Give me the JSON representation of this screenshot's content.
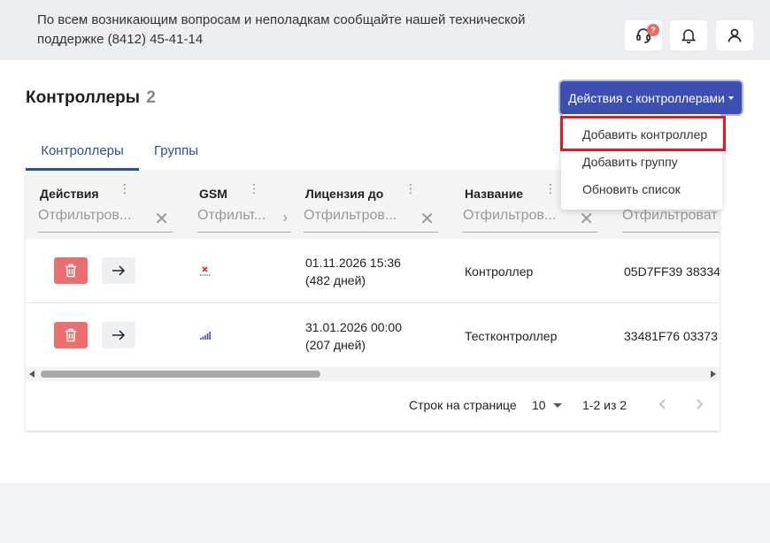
{
  "header": {
    "support_text": "По всем возникающим вопросам и неполадкам сообщайте нашей технической поддержке (8412) 45-41-14",
    "support_badge": "?",
    "icons": [
      "headset-icon",
      "bell-icon",
      "user-icon"
    ]
  },
  "page": {
    "title": "Контроллеры",
    "count": "2"
  },
  "actions": {
    "button_label": "Действия с контроллерами",
    "menu": [
      {
        "label": "Добавить контроллер",
        "highlighted": true
      },
      {
        "label": "Добавить группу"
      },
      {
        "label": "Обновить список"
      }
    ],
    "highlight_color": "#e01b22"
  },
  "tabs": [
    {
      "label": "Контроллеры",
      "active": true
    },
    {
      "label": "Группы",
      "active": false
    }
  ],
  "table": {
    "columns": [
      {
        "label": "Действия",
        "filter_placeholder": "Отфильтров..."
      },
      {
        "label": "GSM",
        "filter_placeholder": "Отфильт..."
      },
      {
        "label": "Лицензия до",
        "filter_placeholder": "Отфильтров..."
      },
      {
        "label": "Название",
        "filter_placeholder": "Отфильтров..."
      },
      {
        "label": "",
        "filter_placeholder": "Отфильтроват"
      }
    ],
    "rows": [
      {
        "gsm_icon": "no-signal-icon",
        "license_date": "01.11.2026 15:36",
        "license_days": "(482 дней)",
        "name": "Контроллер",
        "serial": "05D7FF39 38334"
      },
      {
        "gsm_icon": "signal-bars-icon",
        "license_date": "31.01.2026 00:00",
        "license_days": "(207 дней)",
        "name": "Тестконтроллер",
        "serial": "33481F76 03373"
      }
    ]
  },
  "pagination": {
    "rows_per_page_label": "Строк на странице",
    "rows_per_page": "10",
    "range": "1-2 из 2"
  },
  "colors": {
    "primary": "#3d4fb0",
    "tab_active": "#2d4f93",
    "delete": "#ec6f6f",
    "badge": "#e86a6a"
  }
}
